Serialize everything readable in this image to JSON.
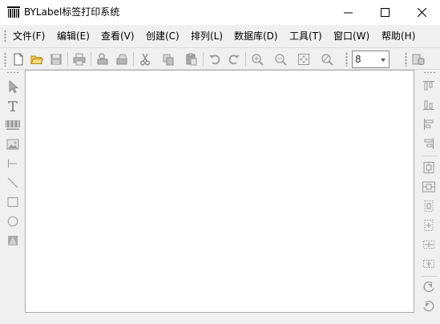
{
  "window": {
    "title": "BYLabel标签打印系统"
  },
  "menubar": {
    "items": [
      {
        "label": "文件(F)"
      },
      {
        "label": "编辑(E)"
      },
      {
        "label": "查看(V)"
      },
      {
        "label": "创建(C)"
      },
      {
        "label": "排列(L)"
      },
      {
        "label": "数据库(D)"
      },
      {
        "label": "工具(T)"
      },
      {
        "label": "窗口(W)"
      },
      {
        "label": "帮助(H)"
      }
    ]
  },
  "toolbar": {
    "icons": [
      "new-file-icon",
      "open-folder-icon",
      "save-icon",
      "print-icon",
      "print-setup-icon",
      "print-preview-icon",
      "cut-icon",
      "copy-icon",
      "paste-icon",
      "undo-icon",
      "redo-icon",
      "zoom-in-icon",
      "zoom-out-icon",
      "fit-page-icon",
      "zoom-tool-icon",
      "database-icon"
    ],
    "zoom_value": "8"
  },
  "left_toolbox": {
    "icons": [
      "select-pointer-icon",
      "text-tool-icon",
      "barcode-tool-icon",
      "image-tool-icon",
      "dimension-line-icon",
      "line-tool-icon",
      "rectangle-tool-icon",
      "ellipse-tool-icon",
      "triangle-tool-icon"
    ]
  },
  "right_toolbox": {
    "icons": [
      "align-top-icon",
      "align-bottom-icon",
      "align-left-icon",
      "align-right-icon",
      "center-vertical-icon",
      "center-horizontal-icon",
      "distribute-vertical-icon",
      "distribute-horizontal-icon",
      "same-width-icon",
      "same-height-icon",
      "rotate-left-icon",
      "rotate-right-icon"
    ]
  },
  "colors": {
    "titlebar_bg": "#ffffff",
    "chrome_bg": "#f0f0f0",
    "canvas_bg": "#ffffff",
    "disabled_icon": "#a0a0a0"
  }
}
